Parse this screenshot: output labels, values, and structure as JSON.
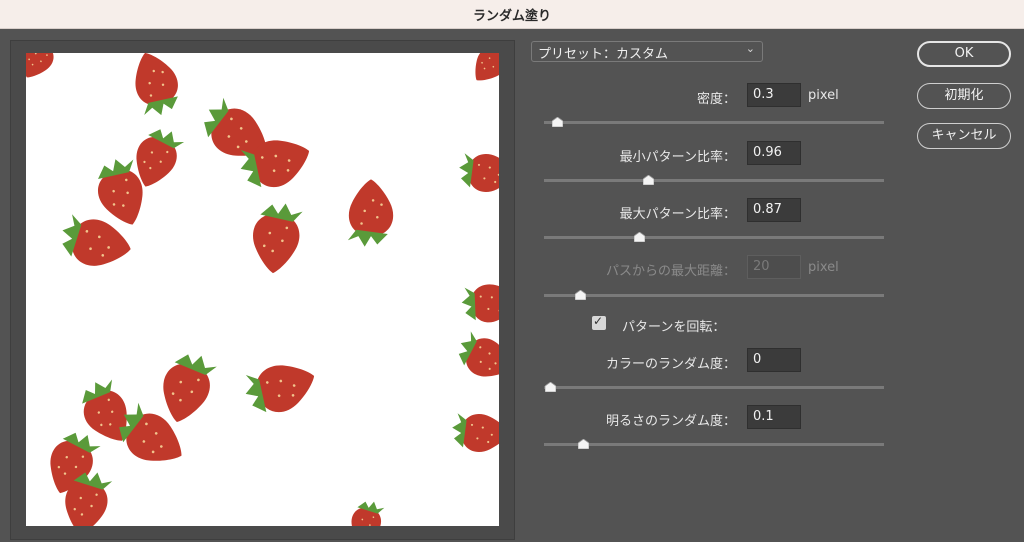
{
  "window": {
    "title": "ランダム塗り"
  },
  "preset": {
    "value": "プリセット：カスタム"
  },
  "params": [
    {
      "label": "密度：",
      "value": "0.3",
      "unit": "pixel",
      "slider": 0.02,
      "enabled": true
    },
    {
      "label": "最小パターン比率：",
      "value": "0.96",
      "unit": "",
      "slider": 0.3,
      "enabled": true
    },
    {
      "label": "最大パターン比率：",
      "value": "0.87",
      "unit": "",
      "slider": 0.27,
      "enabled": true
    },
    {
      "label": "パスからの最大距離：",
      "value": "20",
      "unit": "pixel",
      "slider": 0.09,
      "enabled": false
    }
  ],
  "rotate": {
    "label": "パターンを回転：",
    "checked": true
  },
  "randomness": [
    {
      "label": "カラーのランダム度：",
      "value": "0",
      "slider": 0.0
    },
    {
      "label": "明るさのランダム度：",
      "value": "0.1",
      "slider": 0.1
    }
  ],
  "buttons": {
    "ok": "OK",
    "reset": "初期化",
    "cancel": "キャンセル"
  }
}
